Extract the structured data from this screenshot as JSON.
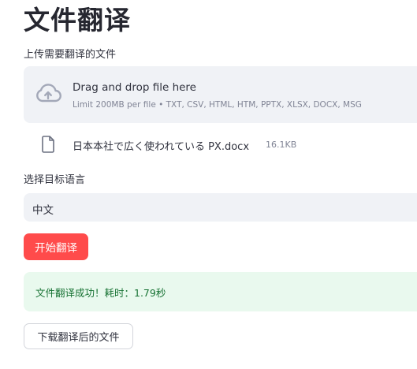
{
  "page": {
    "title": "文件翻译"
  },
  "uploader": {
    "label": "上传需要翻译的文件",
    "drop_text": "Drag and drop file here",
    "limit_text": "Limit 200MB per file • TXT, CSV, HTML, HTM, PPTX, XLSX, DOCX, MSG",
    "icon": "cloud-upload-icon"
  },
  "uploaded_file": {
    "name": "日本本社で広く使われている PX.docx",
    "size": "16.1KB",
    "icon": "file-icon"
  },
  "language_select": {
    "label": "选择目标语言",
    "value": "中文"
  },
  "translate_button": {
    "label": "开始翻译"
  },
  "success_alert": {
    "message": "文件翻译成功！耗时：1.79秒"
  },
  "download_button": {
    "label": "下载翻译后的文件"
  },
  "colors": {
    "primary": "#ff4b4b",
    "widget_bg": "#f0f2f6",
    "success_bg": "#e9f9ee",
    "success_text": "#177233"
  }
}
